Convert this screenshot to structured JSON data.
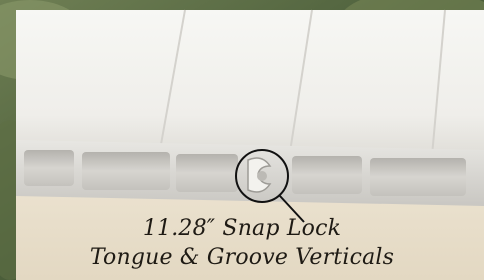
{
  "caption": {
    "line1": "11.28″ Snap Lock",
    "line2": "Tongue & Groove Verticals"
  },
  "colors": {
    "panel": "#f1f0ec",
    "backdrop": "#ebe3d2",
    "foliage": "#55683f",
    "caption_text": "#1e1a14"
  }
}
